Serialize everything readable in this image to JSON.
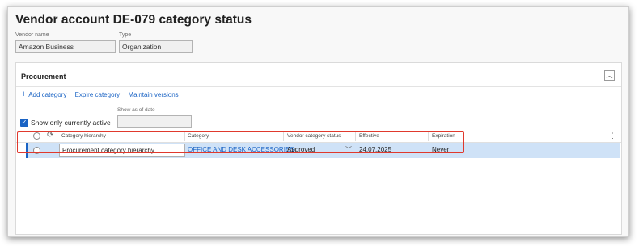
{
  "page": {
    "title": "Vendor account DE-079 category status"
  },
  "header_fields": {
    "vendor_name_label": "Vendor name",
    "vendor_name_value": "Amazon Business",
    "type_label": "Type",
    "type_value": "Organization"
  },
  "procurement": {
    "section_title": "Procurement",
    "collapse_icon": "chevron-up-icon",
    "toolbar": {
      "add_icon": "+",
      "add_category": "Add category",
      "expire_category": "Expire category",
      "maintain_versions": "Maintain versions"
    },
    "show_as_of_date_label": "Show as of date",
    "show_as_of_date_value": "",
    "show_only_active_label": "Show only currently active",
    "show_only_active_checked": true
  },
  "grid": {
    "columns": {
      "hierarchy": "Category hierarchy",
      "category": "Category",
      "status": "Vendor category status",
      "effective": "Effective",
      "expiration": "Expiration"
    },
    "rows": [
      {
        "hierarchy": "Procurement category hierarchy",
        "category": "OFFICE AND DESK ACCESSORIES",
        "status": "Approved",
        "effective": "24.07.2025",
        "expiration": "Never"
      }
    ]
  },
  "colors": {
    "accent": "#1a63c4",
    "selected_row": "#cfe2f7",
    "highlight_border": "#e0392d"
  }
}
